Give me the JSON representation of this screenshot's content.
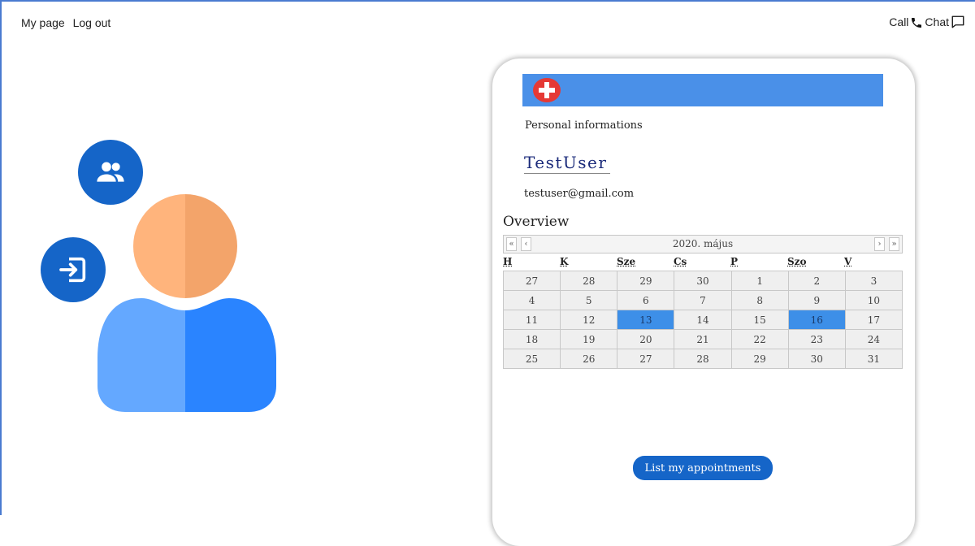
{
  "topnav": {
    "my_page": "My page",
    "log_out": "Log out"
  },
  "contact": {
    "call": "Call",
    "chat": "Chat"
  },
  "profile": {
    "section_label": "Personal informations",
    "username": "TestUser",
    "email": "testuser@gmail.com"
  },
  "overview": {
    "title": "Overview",
    "calendar": {
      "month_label": "2020. május",
      "nav": {
        "prev_year": "«",
        "prev_month": "‹",
        "next_month": "›",
        "next_year": "»"
      },
      "weekdays": [
        "H",
        "K",
        "Sze",
        "Cs",
        "P",
        "Szo",
        "V"
      ],
      "weeks": [
        [
          "27",
          "28",
          "29",
          "30",
          "1",
          "2",
          "3"
        ],
        [
          "4",
          "5",
          "6",
          "7",
          "8",
          "9",
          "10"
        ],
        [
          "11",
          "12",
          "13",
          "14",
          "15",
          "16",
          "17"
        ],
        [
          "18",
          "19",
          "20",
          "21",
          "22",
          "23",
          "24"
        ],
        [
          "25",
          "26",
          "27",
          "28",
          "29",
          "30",
          "31"
        ]
      ],
      "highlighted_days": [
        "13",
        "16"
      ]
    }
  },
  "buttons": {
    "list_appointments": "List my appointments"
  },
  "icons": {
    "people": "people-icon",
    "logout": "logout-icon",
    "plus": "plus-circle-icon",
    "phone": "phone-icon",
    "chat": "chat-bubble-icon"
  },
  "colors": {
    "accent": "#1565c8",
    "header_bar": "#4a90e8",
    "highlight": "#3d8fe8",
    "plus_red": "#e53935",
    "avatar_skin_light": "#ffb47c",
    "avatar_skin_dark": "#f3a46a",
    "avatar_body_light": "#64a8ff",
    "avatar_body_dark": "#2a84ff"
  }
}
